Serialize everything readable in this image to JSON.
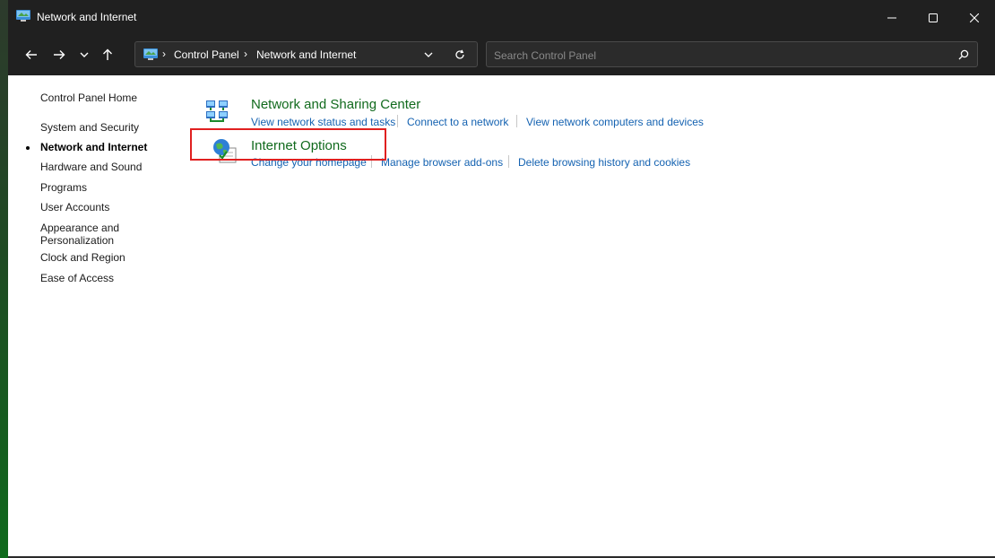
{
  "window": {
    "title": "Network and Internet",
    "controls": {
      "minimize_icon": "minimize-icon",
      "maximize_icon": "maximize-icon",
      "close_icon": "close-icon"
    }
  },
  "navigation": {
    "back_icon": "arrow-left-icon",
    "forward_icon": "arrow-right-icon",
    "recent_icon": "chevron-down-icon",
    "up_icon": "arrow-up-icon"
  },
  "address_bar": {
    "breadcrumbs": [
      "Control Panel",
      "Network and Internet"
    ],
    "separator": "›",
    "dropdown_icon": "chevron-down-icon",
    "refresh_icon": "refresh-icon"
  },
  "search": {
    "placeholder": "Search Control Panel",
    "value": "",
    "icon": "search-icon"
  },
  "sidebar": {
    "items": [
      {
        "label": "Control Panel Home",
        "active": false
      },
      {
        "label": "System and Security",
        "active": false
      },
      {
        "label": "Network and Internet",
        "active": true
      },
      {
        "label": "Hardware and Sound",
        "active": false
      },
      {
        "label": "Programs",
        "active": false
      },
      {
        "label": "User Accounts",
        "active": false
      },
      {
        "label": "Appearance and",
        "active": false
      },
      {
        "label": "Personalization",
        "active": false
      },
      {
        "label": "Clock and Region",
        "active": false
      },
      {
        "label": "Ease of Access",
        "active": false
      }
    ]
  },
  "categories": [
    {
      "title": "Network and Sharing Center",
      "icon": "network-sharing-center-icon",
      "links": [
        "View network status and tasks",
        "Connect to a network",
        "View network computers and devices"
      ]
    },
    {
      "title": "Internet Options",
      "icon": "internet-options-icon",
      "highlighted": true,
      "links": [
        "Change your homepage",
        "Manage browser add-ons",
        "Delete browsing history and cookies"
      ]
    }
  ],
  "colors": {
    "titlebar": "#202020",
    "category_title": "#116a1d",
    "link": "#1462b1",
    "highlight": "#e02020"
  }
}
